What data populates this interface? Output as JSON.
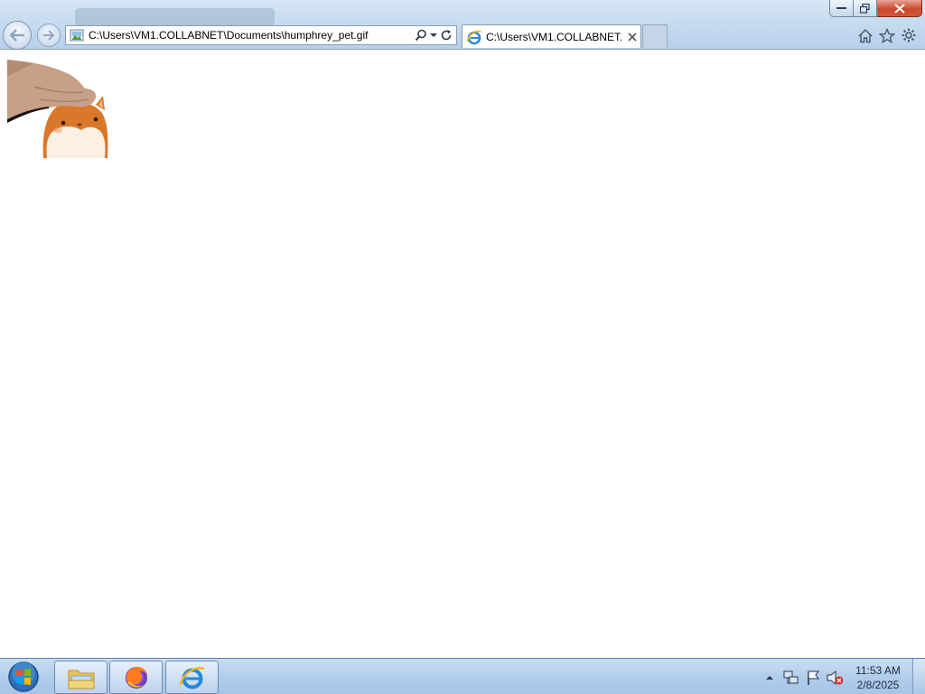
{
  "browser": {
    "address_url": "C:\\Users\\VM1.COLLABNET\\Documents\\humphrey_pet.gif",
    "active_tab_title": "C:\\Users\\VM1.COLLABNET...",
    "icons": [
      "back-icon",
      "forward-icon",
      "search-icon",
      "dropdown-icon",
      "refresh-icon",
      "close-icon",
      "home-icon",
      "favorites-star-icon",
      "gear-icon"
    ]
  },
  "content": {
    "image_name": "humphrey_pet.gif"
  },
  "taskbar": {
    "pinned": [
      "windows-explorer",
      "firefox",
      "internet-explorer"
    ],
    "clock_time": "11:53 AM",
    "clock_date": "2/8/2025"
  },
  "colors": {
    "chrome_bg": "#c4d9ef",
    "close_button": "#c84b2d",
    "taskbar_bg": "#b2cdec",
    "hamster_orange": "#d9782a"
  }
}
